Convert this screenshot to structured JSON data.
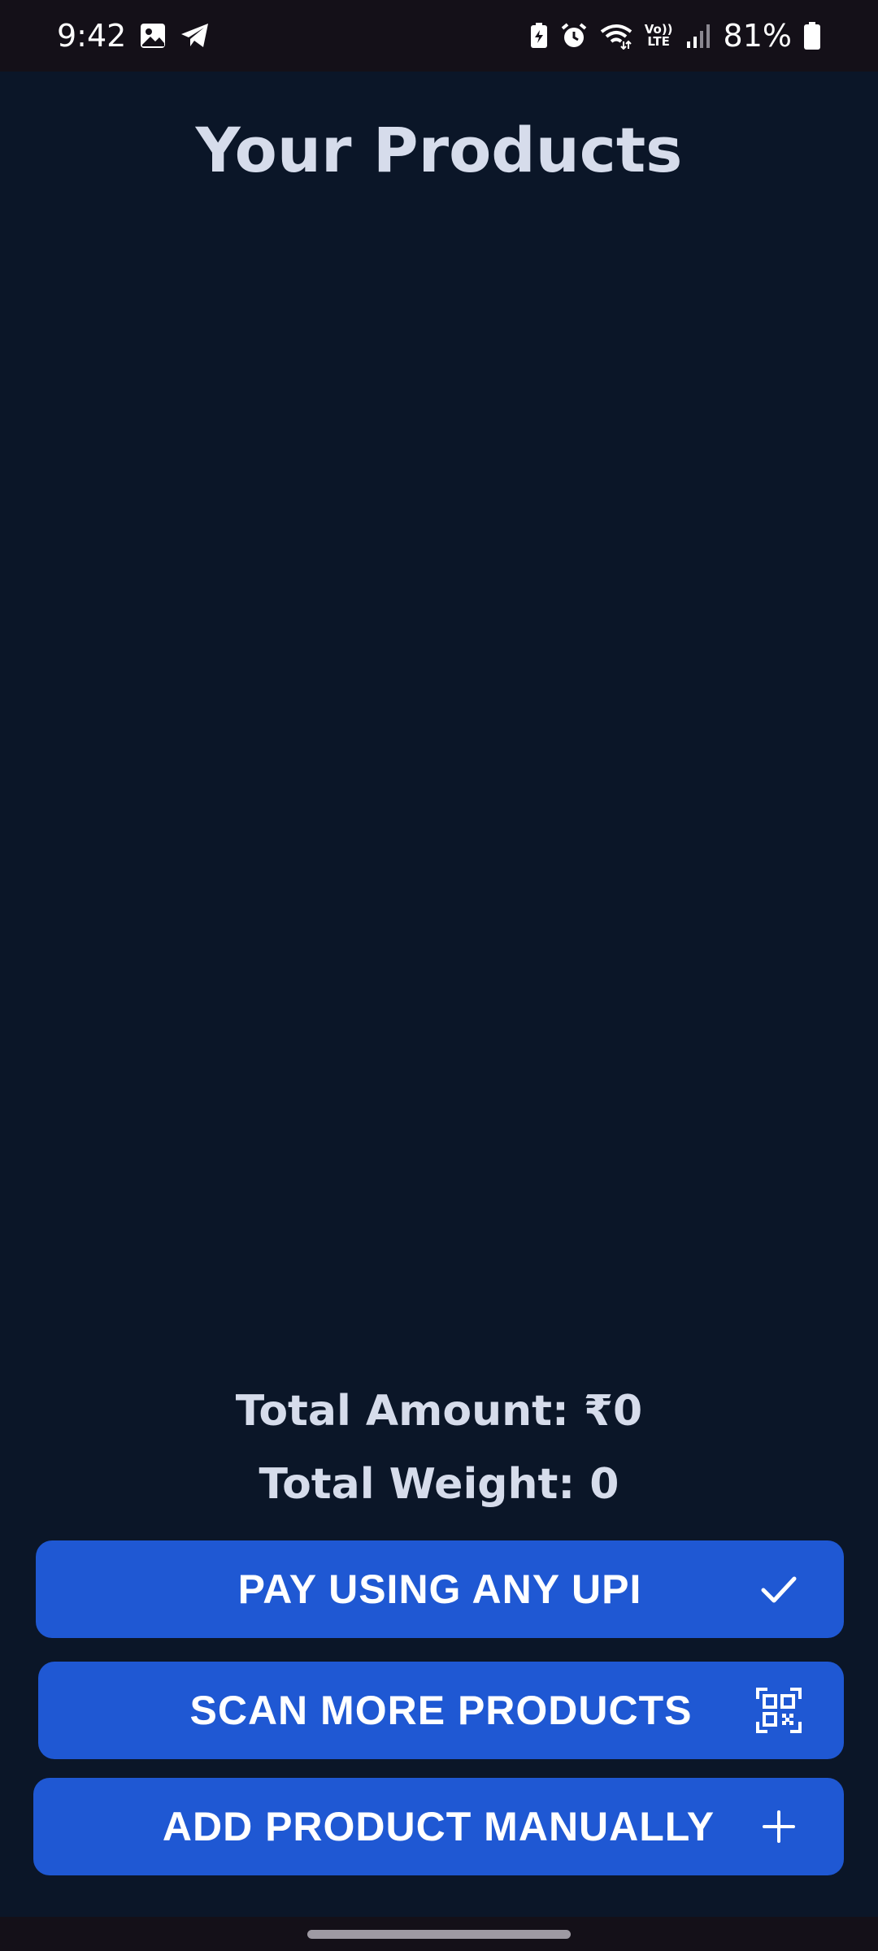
{
  "status_bar": {
    "time": "9:42",
    "left_icons": [
      "gallery-icon",
      "telegram-icon"
    ],
    "right_icons": [
      "battery-saver-icon",
      "alarm-icon",
      "wifi-icon",
      "volte-icon",
      "signal-icon",
      "battery-icon"
    ],
    "volte_label_top": "Vo))",
    "volte_label_bottom": "LTE",
    "battery_percent": "81%"
  },
  "header": {
    "title": "Your Products"
  },
  "products": [],
  "totals": {
    "amount_text": "Total Amount: ₹0",
    "weight_text": "Total Weight: 0"
  },
  "actions": {
    "pay": {
      "label": "PAY USING ANY UPI",
      "icon": "check-icon"
    },
    "scan": {
      "label": "SCAN MORE PRODUCTS",
      "icon": "qr-code-icon"
    },
    "add": {
      "label": "ADD PRODUCT MANUALLY",
      "icon": "plus-icon"
    }
  },
  "colors": {
    "background": "#0b1628",
    "button": "#1f58d3",
    "text": "#d6dceb",
    "status_bar": "#141018"
  }
}
